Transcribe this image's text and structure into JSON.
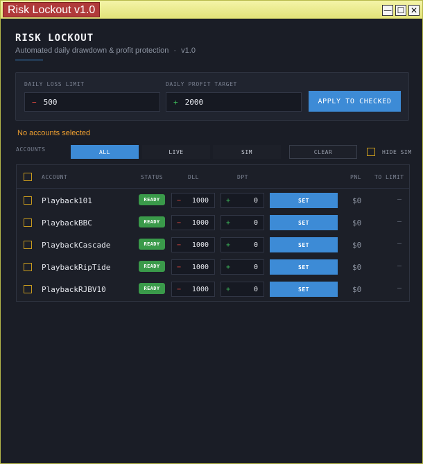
{
  "window": {
    "title": "Risk Lockout v1.0",
    "minimize_glyph": "—",
    "maximize_glyph": "☐",
    "close_glyph": "✕"
  },
  "header": {
    "title": "RISK LOCKOUT",
    "subtitle": "Automated daily drawdown & profit protection",
    "separator": "·",
    "version": "v1.0"
  },
  "limits": {
    "loss_label": "DAILY LOSS LIMIT",
    "loss_sign": "−",
    "loss_value": "500",
    "profit_label": "DAILY PROFIT TARGET",
    "profit_sign": "+",
    "profit_value": "2000",
    "apply_label": "APPLY TO CHECKED"
  },
  "status_message": "No accounts selected",
  "filters": {
    "label": "ACCOUNTS",
    "tabs": [
      {
        "label": "ALL",
        "active": true
      },
      {
        "label": "LIVE",
        "active": false
      },
      {
        "label": "SIM",
        "active": false
      }
    ],
    "clear_label": "CLEAR",
    "hide_sim_label": "HIDE SIM"
  },
  "table": {
    "columns": {
      "account": "ACCOUNT",
      "status": "STATUS",
      "dll": "DLL",
      "dpt": "DPT",
      "pnl": "PNL",
      "to_limit": "TO LIMIT"
    },
    "rows": [
      {
        "account": "Playback101",
        "status": "READY",
        "dll_sign": "−",
        "dll": "1000",
        "dpt_sign": "+",
        "dpt": "0",
        "set_label": "SET",
        "pnl": "$0",
        "to_limit": "–"
      },
      {
        "account": "PlaybackBBC",
        "status": "READY",
        "dll_sign": "−",
        "dll": "1000",
        "dpt_sign": "+",
        "dpt": "0",
        "set_label": "SET",
        "pnl": "$0",
        "to_limit": "–"
      },
      {
        "account": "PlaybackCascade",
        "status": "READY",
        "dll_sign": "−",
        "dll": "1000",
        "dpt_sign": "+",
        "dpt": "0",
        "set_label": "SET",
        "pnl": "$0",
        "to_limit": "–"
      },
      {
        "account": "PlaybackRipTide",
        "status": "READY",
        "dll_sign": "−",
        "dll": "1000",
        "dpt_sign": "+",
        "dpt": "0",
        "set_label": "SET",
        "pnl": "$0",
        "to_limit": "–"
      },
      {
        "account": "PlaybackRJBV10",
        "status": "READY",
        "dll_sign": "−",
        "dll": "1000",
        "dpt_sign": "+",
        "dpt": "0",
        "set_label": "SET",
        "pnl": "$0",
        "to_limit": "–"
      }
    ]
  },
  "colors": {
    "accent": "#3d8bd6",
    "loss": "#e0493f",
    "profit": "#3dbb5a",
    "ready": "#3a9a4a",
    "warning": "#f0a030",
    "checkbox": "#c79a1e",
    "background": "#1a1d26"
  }
}
